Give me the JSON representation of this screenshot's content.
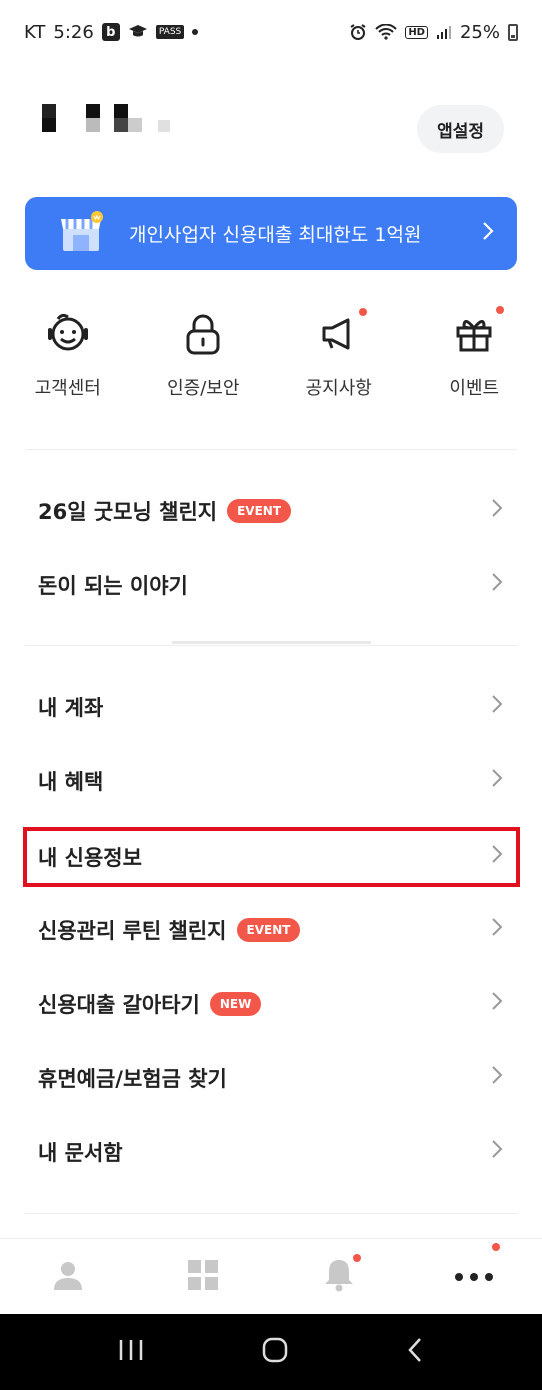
{
  "status_bar": {
    "carrier": "KT",
    "time": "5:26",
    "icons_left": [
      "b-app-icon",
      "graduation-cap-icon",
      "pass-icon",
      "dot-icon"
    ],
    "pass_label": "PASS",
    "hd_label": "HD",
    "battery": "25%"
  },
  "header": {
    "app_settings_label": "앱설정"
  },
  "banner": {
    "text": "개인사업자 신용대출 최대한도 1억원",
    "color": "#3d7cf5"
  },
  "quick_menu": [
    {
      "label": "고객센터",
      "icon": "headset-face-icon",
      "dot": false
    },
    {
      "label": "인증/보안",
      "icon": "lock-icon",
      "dot": false
    },
    {
      "label": "공지사항",
      "icon": "megaphone-icon",
      "dot": true
    },
    {
      "label": "이벤트",
      "icon": "gift-icon",
      "dot": true
    }
  ],
  "section1": [
    {
      "label": "26일 굿모닝 챌린지",
      "badge": "EVENT"
    },
    {
      "label": "돈이 되는 이야기",
      "badge": ""
    }
  ],
  "section2": [
    {
      "label": "내 계좌",
      "badge": ""
    },
    {
      "label": "내 혜택",
      "badge": ""
    },
    {
      "label": "내 신용정보",
      "badge": "",
      "highlighted": true
    },
    {
      "label": "신용관리 루틴 챌린지",
      "badge": "EVENT"
    },
    {
      "label": "신용대출 갈아타기",
      "badge": "NEW"
    },
    {
      "label": "휴면예금/보험금 찾기",
      "badge": ""
    },
    {
      "label": "내 문서함",
      "badge": ""
    }
  ],
  "bottom_nav": [
    {
      "icon": "person-icon",
      "dot": false,
      "active": false
    },
    {
      "icon": "grid-icon",
      "dot": false,
      "active": false
    },
    {
      "icon": "bell-icon",
      "dot": true,
      "active": false
    },
    {
      "icon": "more-icon",
      "dot": true,
      "active": true
    }
  ],
  "colors": {
    "accent": "#3d7cf5",
    "badge": "#f2574a",
    "highlight_border": "#e0101e"
  }
}
